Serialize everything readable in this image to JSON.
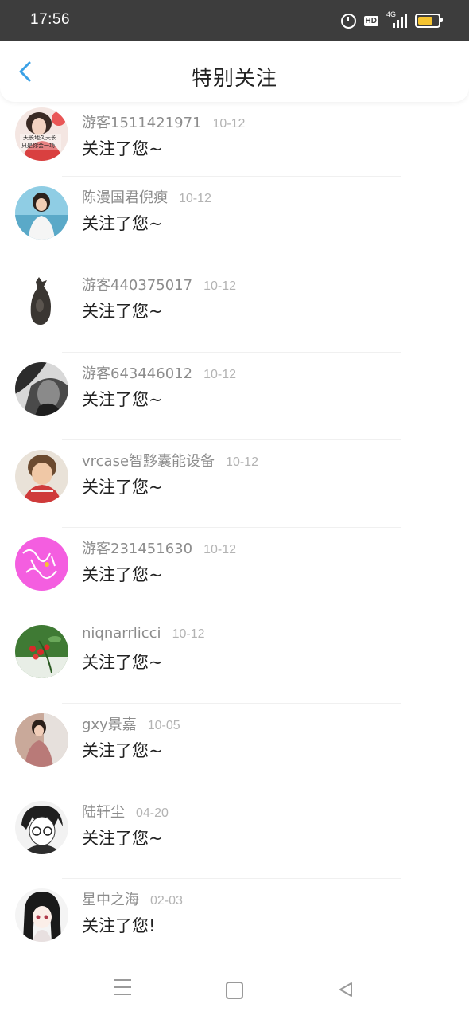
{
  "status_bar": {
    "time": "17:56",
    "hd_label": "HD",
    "network_label": "4G",
    "icons": [
      "alarm-icon",
      "hd-icon",
      "signal-4g-icon",
      "battery-icon"
    ]
  },
  "header": {
    "title": "特别关注",
    "back_icon": "chevron-left-icon",
    "accent_color": "#3ba1e6"
  },
  "notifications": [
    {
      "name": "游客1511421971",
      "date": "10-12",
      "message": "关注了您~"
    },
    {
      "name": "陈漫国君倪瘐",
      "date": "10-12",
      "message": "关注了您~"
    },
    {
      "name": "游客440375017",
      "date": "10-12",
      "message": "关注了您~"
    },
    {
      "name": "游客643446012",
      "date": "10-12",
      "message": "关注了您~"
    },
    {
      "name": "vrcase智黟囊能设备",
      "date": "10-12",
      "message": "关注了您~"
    },
    {
      "name": "游客231451630",
      "date": "10-12",
      "message": "关注了您~"
    },
    {
      "name": "niqnarrlicci",
      "date": "10-12",
      "message": "关注了您~"
    },
    {
      "name": "gxy景嘉",
      "date": "10-05",
      "message": "关注了您~"
    },
    {
      "name": "陆轩尘",
      "date": "04-20",
      "message": "关注了您~"
    },
    {
      "name": "星中之海",
      "date": "02-03",
      "message": "关注了您!"
    }
  ],
  "avatar_text": {
    "line1": "天长地久天长",
    "line2": "只是你会一场"
  },
  "system_nav": [
    "menu-icon",
    "home-icon",
    "back-triangle-icon"
  ]
}
